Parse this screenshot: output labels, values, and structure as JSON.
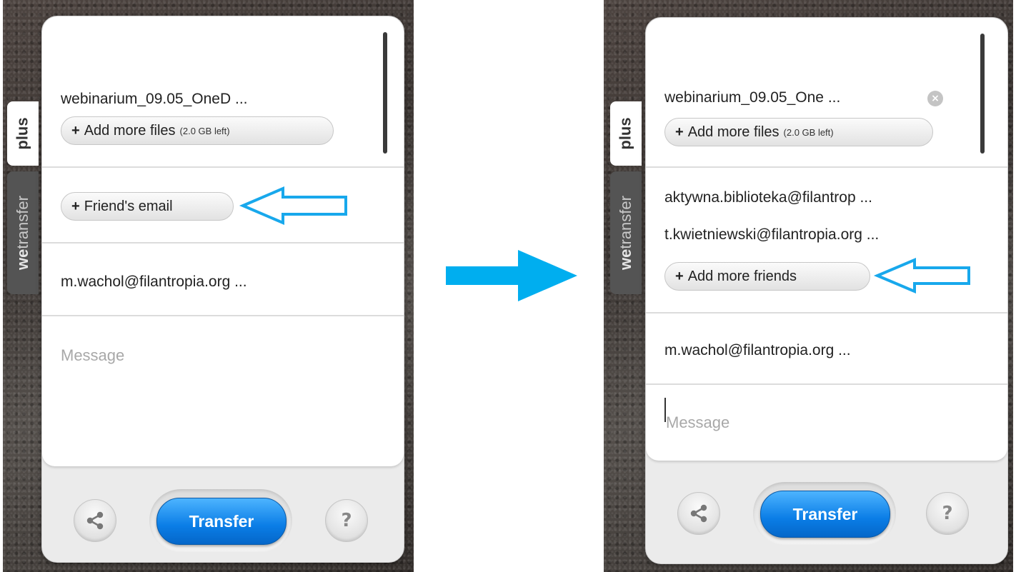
{
  "colors": {
    "accent": "#1a8fee",
    "annotation": "#18a8ec"
  },
  "left": {
    "tabs": {
      "plus": "plus",
      "we": "we",
      "transfer": "transfer"
    },
    "file_name": "webinarium_09.05_OneD ...",
    "add_files": {
      "label": "Add more files",
      "left": "(2.0 GB left)"
    },
    "friend_email_button": "Friend's email",
    "sender_email": "m.wachol@filantropia.org ...",
    "message_placeholder": "Message",
    "transfer_button": "Transfer",
    "help_button": "?",
    "share_icon": "share-icon"
  },
  "right": {
    "tabs": {
      "plus": "plus",
      "we": "we",
      "transfer": "transfer"
    },
    "file_name": "webinarium_09.05_One ...",
    "add_files": {
      "label": "Add more files",
      "left": "(2.0 GB left)"
    },
    "recipients": [
      "aktywna.biblioteka@filantrop ...",
      "t.kwietniewski@filantropia.org ..."
    ],
    "add_friends_button": "Add more friends",
    "sender_email": "m.wachol@filantropia.org ...",
    "message_placeholder": "Message",
    "transfer_button": "Transfer",
    "help_button": "?",
    "share_icon": "share-icon",
    "remove_icon": "close-circle-icon"
  }
}
